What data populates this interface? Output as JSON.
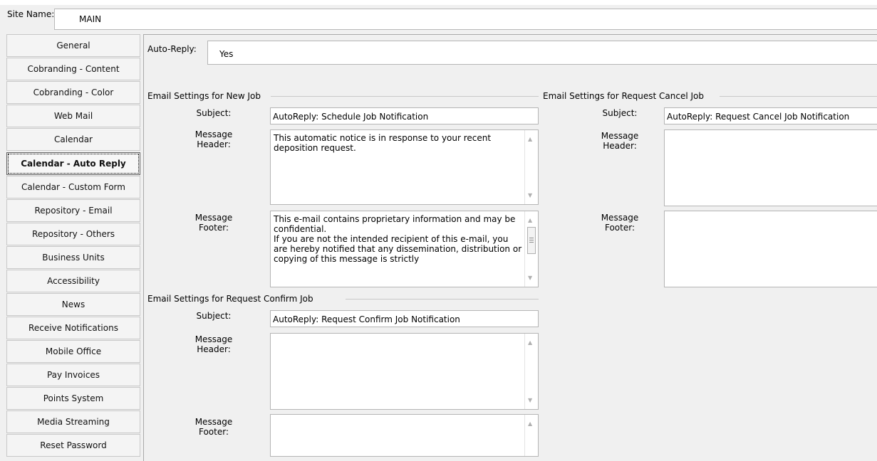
{
  "site": {
    "label": "Site Name:",
    "value": "MAIN"
  },
  "sidebar": {
    "items": [
      "General",
      "Cobranding - Content",
      "Cobranding - Color",
      "Web Mail",
      "Calendar",
      "Calendar - Auto Reply",
      "Calendar - Custom Form",
      "Repository - Email",
      "Repository - Others",
      "Business Units",
      "Accessibility",
      "News",
      "Receive Notifications",
      "Mobile Office",
      "Pay Invoices",
      "Points System",
      "Media Streaming",
      "Reset Password"
    ],
    "active_index": 5
  },
  "auto_reply": {
    "label": "Auto-Reply:",
    "value": "Yes"
  },
  "labels": {
    "subject": "Subject:",
    "message": "Message",
    "header": "Header:",
    "footer": "Footer:"
  },
  "new_job": {
    "title": "Email Settings for New Job",
    "subject": "AutoReply: Schedule Job Notification",
    "header": "This automatic notice is in response to your recent deposition request.",
    "footer": "This e-mail contains proprietary information and may be confidential.\nIf you are not the intended recipient of this e-mail, you are hereby notified that any dissemination, distribution or copying of this message is strictly"
  },
  "cancel_job": {
    "title": "Email Settings for Request Cancel Job",
    "subject": "AutoReply: Request Cancel Job Notification",
    "header": "",
    "footer": ""
  },
  "confirm_job": {
    "title": "Email Settings for Request Confirm Job",
    "subject": "AutoReply: Request Confirm Job Notification",
    "header": "",
    "footer": ""
  }
}
